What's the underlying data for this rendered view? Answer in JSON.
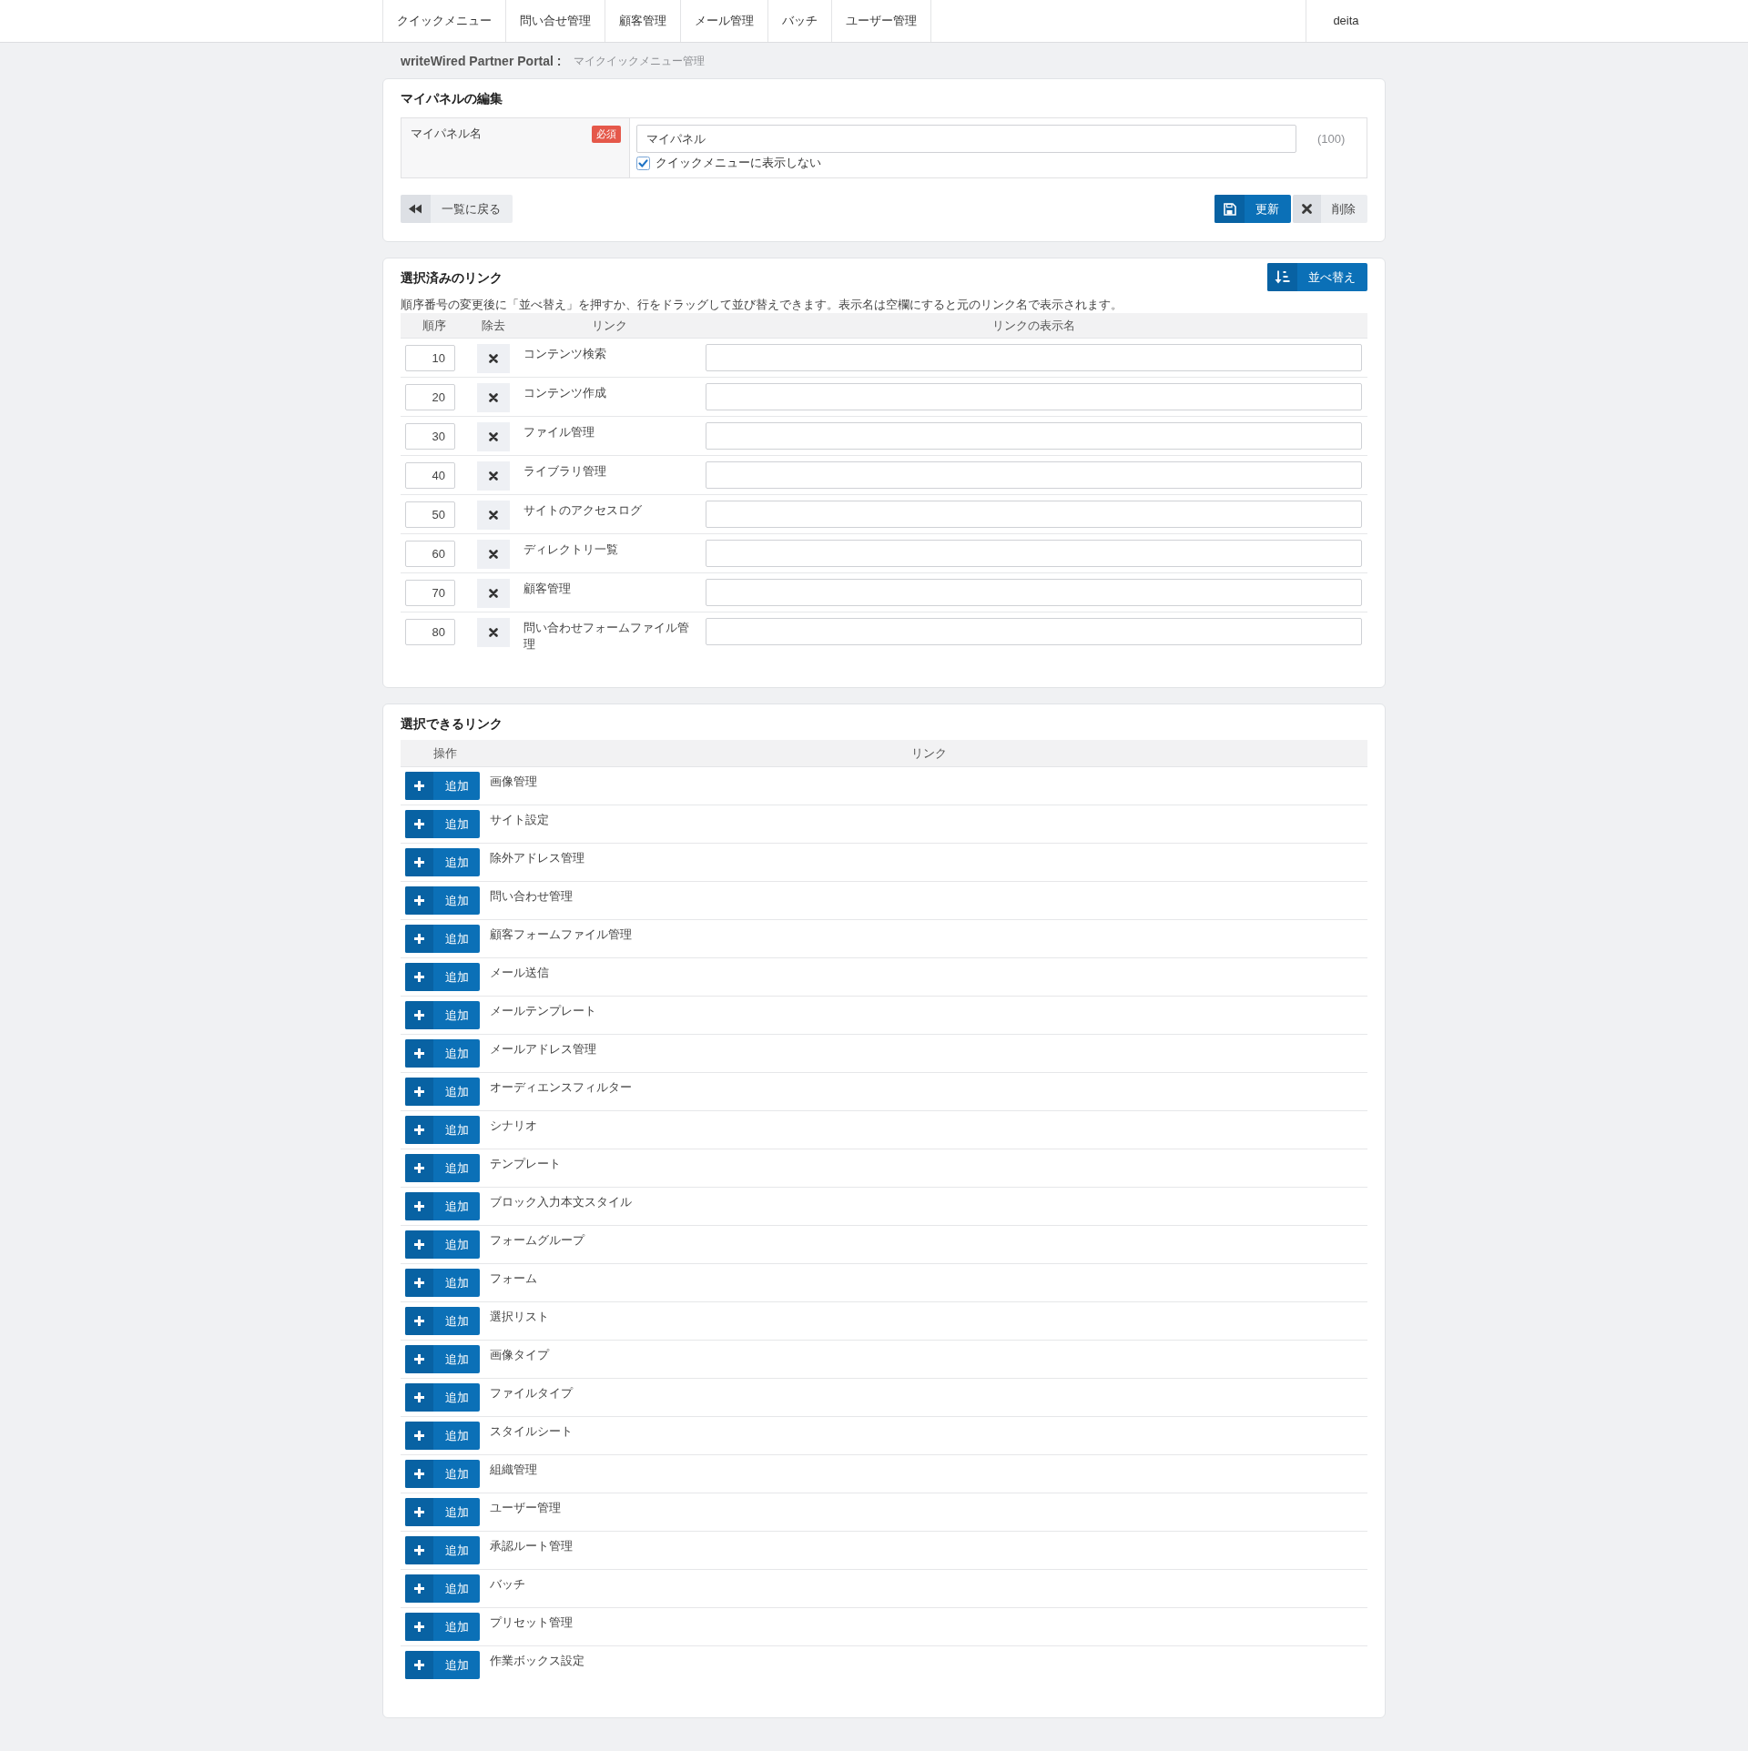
{
  "nav": {
    "items": [
      {
        "label": "クイックメニュー",
        "selected": false
      },
      {
        "label": "問い合せ管理",
        "selected": false
      },
      {
        "label": "顧客管理",
        "selected": false
      },
      {
        "label": "メール管理",
        "selected": false
      },
      {
        "label": "バッチ",
        "selected": false
      },
      {
        "label": "ユーザー管理",
        "selected": false
      }
    ],
    "user": "deita"
  },
  "breadcrumb": {
    "site": "writeWired Partner Portal :",
    "page": "マイクイックメニュー管理"
  },
  "edit_panel": {
    "title": "マイパネルの編集",
    "field": {
      "label": "マイパネル名",
      "required": "必須",
      "value": "マイパネル",
      "limit": "(100)",
      "checkbox": {
        "label": "クイックメニューに表示しない",
        "checked": true
      }
    },
    "back_button": "一覧に戻る",
    "update_button": "更新",
    "delete_button": "削除"
  },
  "selected_links": {
    "title": "選択済みのリンク",
    "sort_button": "並べ替え",
    "description": "順序番号の変更後に「並べ替え」を押すか、行をドラッグして並び替えできます。表示名は空欄にすると元のリンク名で表示されます。",
    "columns": [
      "順序",
      "除去",
      "リンク",
      "リンクの表示名"
    ],
    "rows": [
      {
        "order": "10",
        "link": "コンテンツ検索"
      },
      {
        "order": "20",
        "link": "コンテンツ作成"
      },
      {
        "order": "30",
        "link": "ファイル管理"
      },
      {
        "order": "40",
        "link": "ライブラリ管理"
      },
      {
        "order": "50",
        "link": "サイトのアクセスログ"
      },
      {
        "order": "60",
        "link": "ディレクトリ一覧"
      },
      {
        "order": "70",
        "link": "顧客管理"
      },
      {
        "order": "80",
        "link": "問い合わせフォームファイル管理"
      }
    ]
  },
  "available_links": {
    "title": "選択できるリンク",
    "columns": [
      "操作",
      "リンク"
    ],
    "rows": [
      {
        "button": "追加",
        "link": "画像管理"
      },
      {
        "button": "追加",
        "link": "サイト設定"
      },
      {
        "button": "追加",
        "link": "除外アドレス管理"
      },
      {
        "button": "追加",
        "link": "問い合わせ管理"
      },
      {
        "button": "追加",
        "link": "顧客フォームファイル管理"
      },
      {
        "button": "追加",
        "link": "メール送信"
      },
      {
        "button": "追加",
        "link": "メールテンプレート"
      },
      {
        "button": "追加",
        "link": "メールアドレス管理"
      },
      {
        "button": "追加",
        "link": "オーディエンスフィルター"
      },
      {
        "button": "追加",
        "link": "シナリオ"
      },
      {
        "button": "追加",
        "link": "テンプレート"
      },
      {
        "button": "追加",
        "link": "ブロック入力本文スタイル"
      },
      {
        "button": "追加",
        "link": "フォームグループ"
      },
      {
        "button": "追加",
        "link": "フォーム"
      },
      {
        "button": "追加",
        "link": "選択リスト"
      },
      {
        "button": "追加",
        "link": "画像タイプ"
      },
      {
        "button": "追加",
        "link": "ファイルタイプ"
      },
      {
        "button": "追加",
        "link": "スタイルシート"
      },
      {
        "button": "追加",
        "link": "組織管理"
      },
      {
        "button": "追加",
        "link": "ユーザー管理"
      },
      {
        "button": "追加",
        "link": "承認ルート管理"
      },
      {
        "button": "追加",
        "link": "バッチ"
      },
      {
        "button": "追加",
        "link": "プリセット管理"
      },
      {
        "button": "追加",
        "link": "作業ボックス設定"
      }
    ]
  }
}
